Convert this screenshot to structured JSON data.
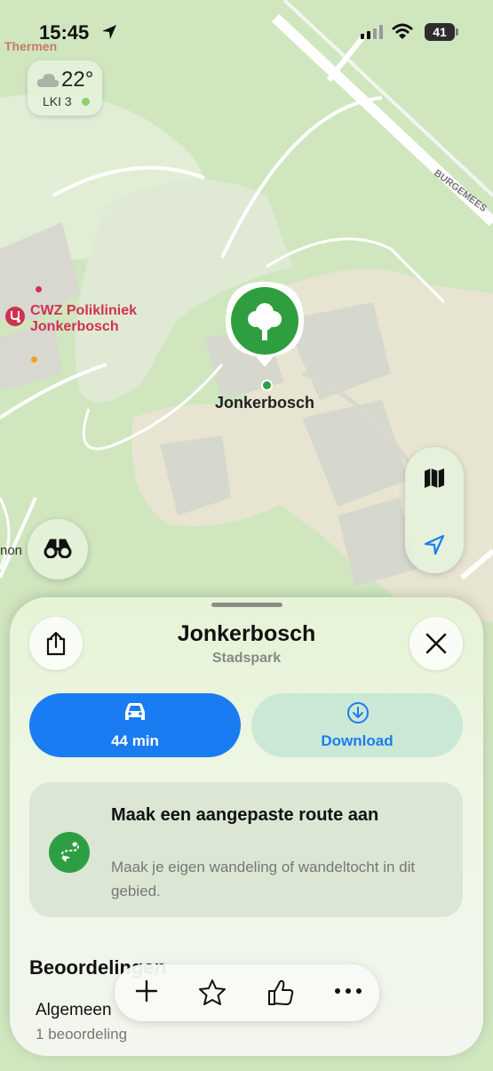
{
  "status_bar": {
    "time": "15:45",
    "battery": "41",
    "icons": [
      "location-arrow-icon",
      "signal-icon",
      "wifi-icon",
      "battery-icon"
    ]
  },
  "map": {
    "labels": {
      "thermen": "Thermen",
      "poi_line1": "CWZ Polikliniek",
      "poi_line2": "Jonkerbosch",
      "street": "BURGEMEES",
      "pin_label": "Jonkerbosch",
      "edge_text": "non"
    },
    "weather": {
      "temperature": "22°",
      "air_quality": "LKI 3",
      "icon": "cloud-icon"
    },
    "controls": {
      "look_around_icon": "binoculars-icon",
      "map_mode_icon": "map-icon",
      "locate_icon": "location-arrow-icon"
    },
    "colors": {
      "park_green": "#cfe6bf",
      "pin_green": "#2f9e3f",
      "poi_red": "#d0314f"
    }
  },
  "sheet": {
    "title": "Jonkerbosch",
    "subtitle": "Stadspark",
    "share_icon": "share-icon",
    "close_icon": "close-icon",
    "drive_button": {
      "icon": "car-icon",
      "label": "44 min"
    },
    "download_button": {
      "icon": "download-icon",
      "label": "Download"
    },
    "route_card": {
      "title": "Maak een aangepaste route aan",
      "description": "Maak je eigen wandeling of wandeltocht in dit gebied.",
      "icon": "route-icon"
    },
    "ratings": {
      "header": "Beoordelingen",
      "overall": "Algemeen",
      "count": "1 beoordeling"
    },
    "action_bar": {
      "items": [
        "add-icon",
        "favorite-icon",
        "like-icon",
        "more-icon"
      ]
    },
    "colors": {
      "accent_blue": "#1a7cf2",
      "download_bg": "#cbe8d6"
    }
  }
}
